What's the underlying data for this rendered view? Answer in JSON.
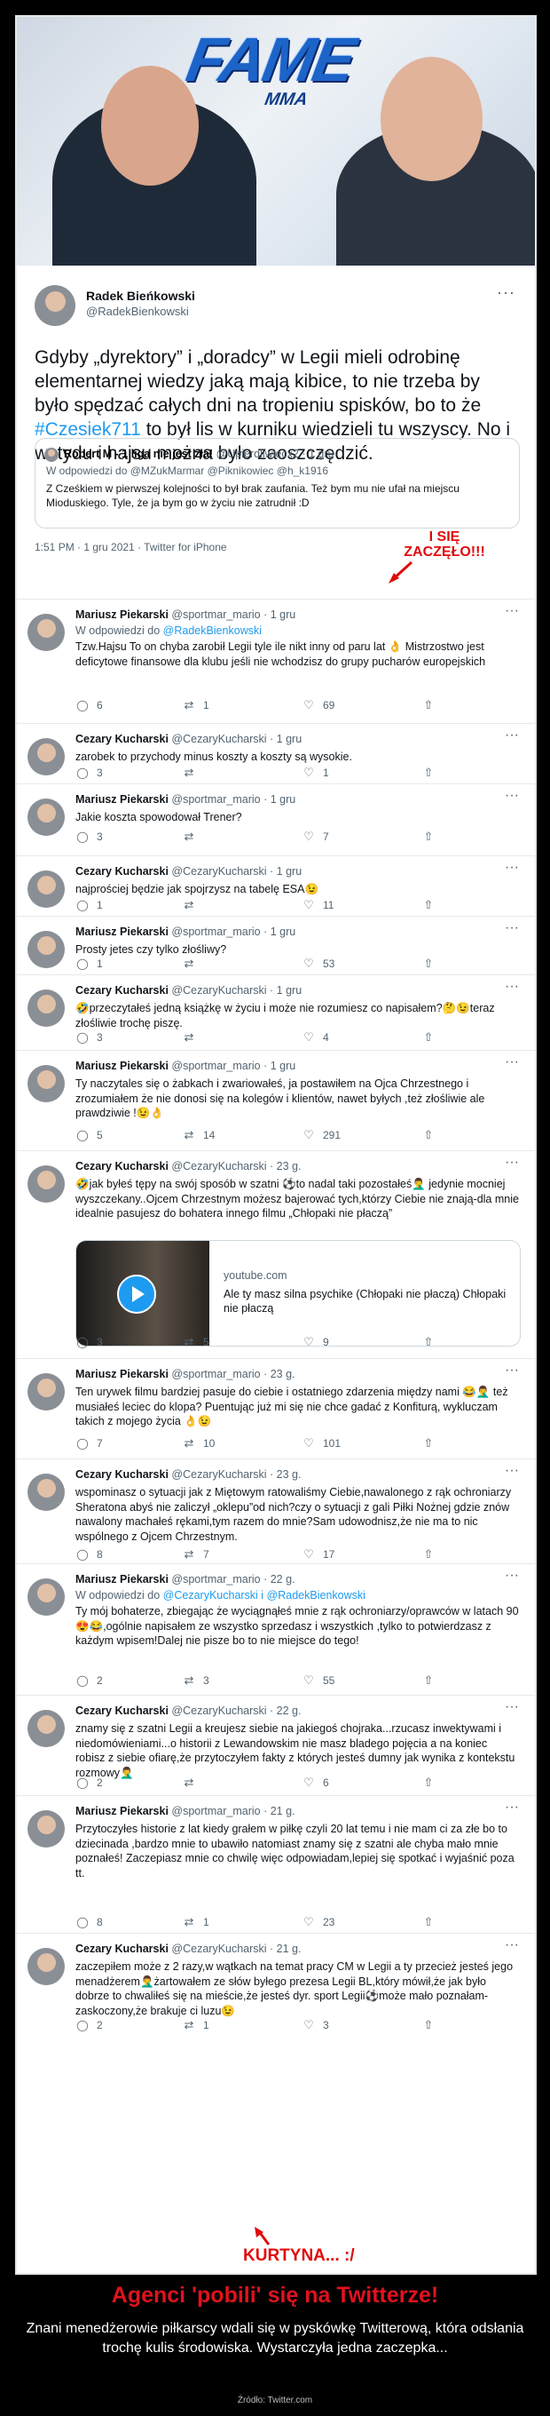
{
  "header": {
    "logo_text": "FAME",
    "logo_sub": "MMA"
  },
  "tweet": {
    "author_name": "Radek Bieńkowski",
    "author_handle": "@RadekBienkowski",
    "text_part1": "Gdyby „dyrektory” i „doradcy” w Legii mieli odrobinę elementarnej wiedzy jaką mają kibice, to nie trzeba by było spędzać całych dni na tropieniu spisków, bo to że ",
    "hashtag": "#Czesiek711",
    "text_part2": " to był lis w kurniku wiedzieli tu wszyscy. No i wstydu i hajsu można było zaoszczędzić.",
    "quote_name": "Robert M - 1 liga nie jest zła!",
    "quote_handle": "@Upierdliwiecx2 · 1 gru",
    "quote_reply_to": "W odpowiedzi do @MZukMarmar @Piknikowiec @h_k1916",
    "quote_text": "Z Cześkiem w pierwszej kolejności to był brak zaufania. Też bym mu nie ufał na miejscu Mioduskiego. Tyle, że ja bym go w życiu nie zatrudnił :D",
    "meta": "1:51 PM · 1 gru 2021 · Twitter for iPhone",
    "callout": "I SIĘ\nZACZĘŁO!!!"
  },
  "replies": [
    {
      "name": "Mariusz Piekarski",
      "handle": "@sportmar_mario · 1 gru",
      "reply_to_prefix": "W odpowiedzi do ",
      "reply_to": "@RadekBienkowski",
      "text": "Tzw.Hajsu To on chyba zarobił Legii tyle ile nikt inny od paru lat 👌 Mistrzostwo jest deficytowe finansowe dla klubu jeśli nie wchodzisz do grupy pucharów europejskich",
      "replies": "6",
      "retweets": "1",
      "likes": "69"
    },
    {
      "name": "Cezary Kucharski",
      "handle": "@CezaryKucharski · 1 gru",
      "text": "zarobek to przychody minus koszty a koszty są wysokie.",
      "replies": "3",
      "retweets": "",
      "likes": "1"
    },
    {
      "name": "Mariusz Piekarski",
      "handle": "@sportmar_mario · 1 gru",
      "text": "Jakie koszta spowodował Trener?",
      "replies": "3",
      "retweets": "",
      "likes": "7"
    },
    {
      "name": "Cezary Kucharski",
      "handle": "@CezaryKucharski · 1 gru",
      "text": "najprościej będzie jak spojrzysz na tabelę ESA😉",
      "replies": "1",
      "retweets": "",
      "likes": "11"
    },
    {
      "name": "Mariusz Piekarski",
      "handle": "@sportmar_mario · 1 gru",
      "text": "Prosty jetes czy tylko złośliwy?",
      "replies": "1",
      "retweets": "",
      "likes": "53"
    },
    {
      "name": "Cezary Kucharski",
      "handle": "@CezaryKucharski · 1 gru",
      "text": "🤣przeczytałeś jedną książkę w życiu i może nie rozumiesz co napisałem?🤔😉teraz złośliwie trochę piszę.",
      "replies": "3",
      "retweets": "",
      "likes": "4"
    },
    {
      "name": "Mariusz Piekarski",
      "handle": "@sportmar_mario · 1 gru",
      "text": "Ty naczytales się o żabkach i zwariowałeś, ja postawiłem na Ojca Chrzestnego i zrozumiałem że nie donosi się na kolegów i klientów, nawet byłych ,też złośliwie ale prawdziwie !😉👌",
      "replies": "5",
      "retweets": "14",
      "likes": "291"
    },
    {
      "name": "Cezary Kucharski",
      "handle": "@CezaryKucharski · 23 g.",
      "text": "🤣jak byłeś tępy na swój sposób w szatni ⚽to nadal taki pozostałeś🤦‍♂️ jedynie mocniej wyszczekany..Ojcem Chrzestnym możesz bajerować tych,którzy Ciebie nie znają-dla mnie idealnie pasujesz do bohatera innego filmu  „Chłopaki nie płaczą”",
      "card_domain": "youtube.com",
      "card_title": "Ale ty masz silna psychike (Chłopaki nie płaczą) Chłopaki nie płaczą",
      "replies": "3",
      "retweets": "5",
      "likes": "9"
    },
    {
      "name": "Mariusz Piekarski",
      "handle": "@sportmar_mario · 23 g.",
      "text": "Ten urywek filmu bardziej pasuje do ciebie i ostatniego zdarzenia między nami 😂🤦‍♂️ też musiałeś leciec do klopa? Puentując już mi się nie chce gadać z Konfiturą, wykluczam takich z mojego życia 👌😉",
      "replies": "7",
      "retweets": "10",
      "likes": "101"
    },
    {
      "name": "Cezary Kucharski",
      "handle": "@CezaryKucharski · 23 g.",
      "text": "wspominasz o sytuacji jak z Miętowym ratowaliśmy Ciebie,nawalonego z rąk ochroniarzy Sheratona abyś nie zaliczył „oklepu”od nich?czy o sytuacji z gali Piłki Nożnej gdzie znów nawalony machałeś rękami,tym razem do mnie?Sam udowodnisz,że nie ma to nic wspólnego z Ojcem Chrzestnym.",
      "replies": "8",
      "retweets": "7",
      "likes": "17"
    },
    {
      "name": "Mariusz Piekarski",
      "handle": "@sportmar_mario · 22 g.",
      "reply_to_prefix": "W odpowiedzi do ",
      "reply_to": "@CezaryKucharski i @RadekBienkowski",
      "text": "Ty mój bohaterze, zbiegając że wyciągnąłeś mnie z rąk ochroniarzy/oprawców w latach 90 😍😂,ogólnie napisałem ze wszystko sprzedasz i wszystkich ,tylko to potwierdzasz z każdym wpisem!Dalej nie pisze bo to nie miejsce do tego!",
      "replies": "2",
      "retweets": "3",
      "likes": "55"
    },
    {
      "name": "Cezary Kucharski",
      "handle": "@CezaryKucharski · 22 g.",
      "text": "znamy się z szatni Legii a kreujesz siebie na jakiegoś chojraka...rzucasz inwektywami i niedomówieniami...o historii z Lewandowskim nie masz bladego pojęcia a na koniec robisz z siebie ofiarę,że przytoczyłem fakty z których jesteś dumny jak wynika z kontekstu rozmowy🤦‍♂️",
      "replies": "2",
      "retweets": "",
      "likes": "6"
    },
    {
      "name": "Mariusz Piekarski",
      "handle": "@sportmar_mario · 21 g.",
      "text": "Przytoczyłes historie z lat kiedy grałem w piłkę czyli 20 lat temu i nie mam ci za złe bo to dziecinada ,bardzo mnie to ubawiło natomiast znamy się z szatni ale chyba mało mnie poznałeś! Zaczepiasz mnie co chwilę więc odpowiadam,lepiej się spotkać i wyjaśnić poza tt.",
      "replies": "8",
      "retweets": "1",
      "likes": "23"
    },
    {
      "name": "Cezary Kucharski",
      "handle": "@CezaryKucharski · 21 g.",
      "text": "zaczepiłem może z 2 razy,w wątkach na temat pracy CM w Legii a ty przecież jesteś jego menadżerem🤦‍♂️żartowałem ze słów byłego prezesa Legii BL,który mówił,że jak było dobrze to chwaliłeś się na mieście,że jesteś dyr. sport Legii⚽może mało poznałam-zaskoczony,że brakuje ci luzu😉",
      "replies": "2",
      "retweets": "1",
      "likes": "3"
    }
  ],
  "callout_bottom": "KURTYNA... :/",
  "footer": {
    "headline": "Agenci 'pobili' się na Twitterze!",
    "subtitle": "Znani menedżerowie piłkarscy wdali się w pyskówkę Twitterową, która odsłania trochę kulis środowiska. Wystarczyła jedna  zaczepka...",
    "source": "Źródło: Twitter.com"
  },
  "icons": {
    "reply": "reply-icon",
    "retweet": "retweet-icon",
    "like": "heart-icon",
    "share": "share-icon",
    "more": "more-icon"
  },
  "colors": {
    "accent": "#1d9bf0",
    "callout": "#e00b0b",
    "headline": "#e0121e"
  }
}
